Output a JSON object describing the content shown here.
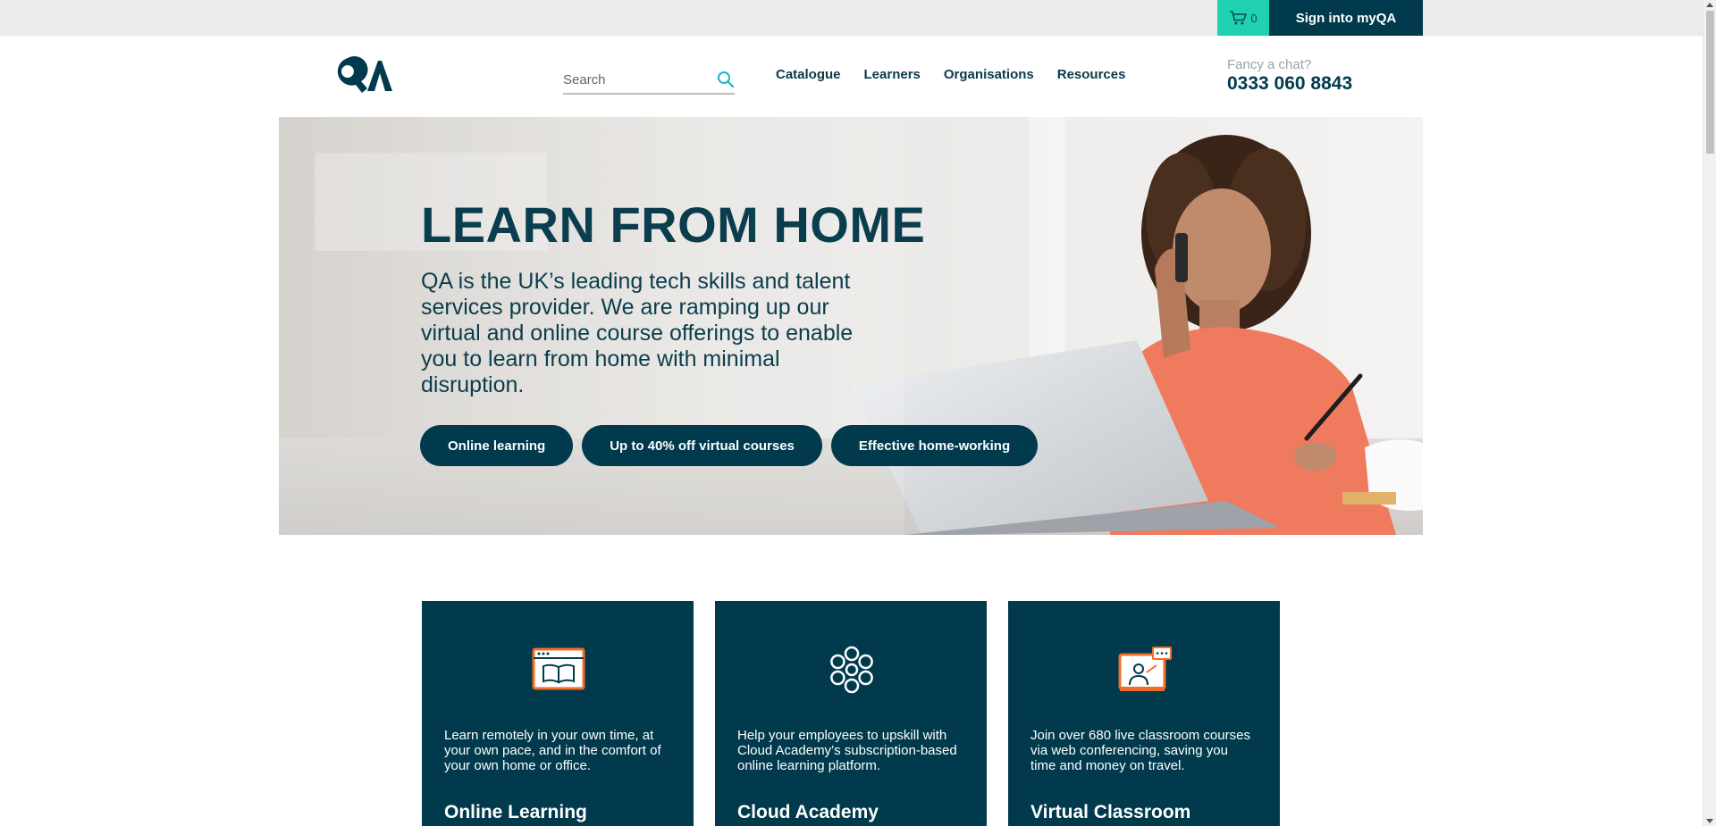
{
  "topbar": {
    "cart_count": "0",
    "signin_label": "Sign into myQA"
  },
  "header": {
    "search_placeholder": "Search",
    "nav": [
      "Catalogue",
      "Learners",
      "Organisations",
      "Resources"
    ],
    "chat_label": "Fancy a chat?",
    "phone": "0333 060 8843"
  },
  "hero": {
    "title": "LEARN FROM HOME",
    "text": "QA is the UK’s leading tech skills and talent services provider. We are ramping up our virtual and online course offerings to enable you to learn from home with minimal disruption.",
    "buttons": [
      "Online learning",
      "Up to 40% off virtual courses",
      "Effective home-working"
    ]
  },
  "cards": [
    {
      "icon": "online-learning-icon",
      "text": "Learn remotely in your own time, at your own pace, and in the comfort of your own home or office.",
      "title": "Online Learning"
    },
    {
      "icon": "cloud-academy-icon",
      "text": "Help your employees to upskill with Cloud Academy’s subscription-based online learning platform.",
      "title": "Cloud Academy"
    },
    {
      "icon": "virtual-classroom-icon",
      "text": "Join over 680 live classroom courses via web conferencing, saving you time and money on travel.",
      "title": "Virtual Classroom"
    }
  ],
  "colors": {
    "brand_dark": "#003a4c",
    "accent_teal": "#1fd1b1",
    "accent_orange": "#f26b2a",
    "topbar_bg": "#ebebeb"
  }
}
